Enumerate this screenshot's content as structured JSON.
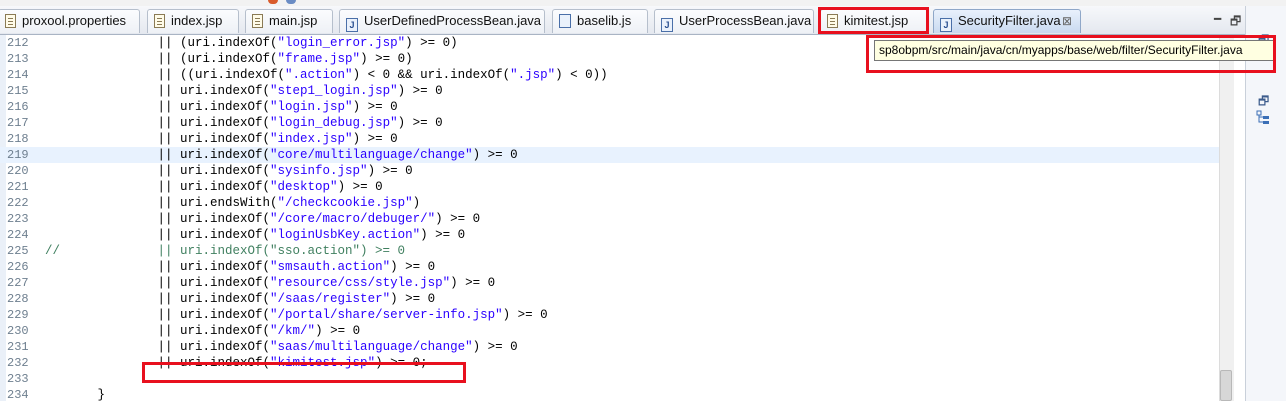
{
  "tabs": [
    {
      "label": "proxool.properties",
      "icon": "file-icon"
    },
    {
      "label": "index.jsp",
      "icon": "file-icon"
    },
    {
      "label": "main.jsp",
      "icon": "file-icon"
    },
    {
      "label": "UserDefinedProcessBean.java",
      "icon": "java-file-icon"
    },
    {
      "label": "baselib.js",
      "icon": "js-file-icon"
    },
    {
      "label": "UserProcessBean.java",
      "icon": "java-file-icon"
    },
    {
      "label": "kimitest.jsp",
      "icon": "file-icon"
    },
    {
      "label": "SecurityFilter.java",
      "icon": "java-file-icon",
      "active": true,
      "close": "⊠"
    }
  ],
  "tooltip": "sp8obpm/src/main/java/cn/myapps/base/web/filter/SecurityFilter.java",
  "window_buttons": {
    "minimize": "━",
    "maximize": "🗗"
  },
  "code_lines": [
    {
      "num": "212",
      "parts": [
        [
          "kw",
          "               || (uri.indexOf("
        ],
        [
          "str",
          "\"login_error.jsp\""
        ],
        [
          "kw",
          ") >= 0)"
        ]
      ]
    },
    {
      "num": "213",
      "parts": [
        [
          "kw",
          "               || (uri.indexOf("
        ],
        [
          "str",
          "\"frame.jsp\""
        ],
        [
          "kw",
          ") >= 0)"
        ]
      ]
    },
    {
      "num": "214",
      "parts": [
        [
          "kw",
          "               || ((uri.indexOf("
        ],
        [
          "str",
          "\".action\""
        ],
        [
          "kw",
          ") < 0 && uri.indexOf("
        ],
        [
          "str",
          "\".jsp\""
        ],
        [
          "kw",
          ") < 0))"
        ]
      ]
    },
    {
      "num": "215",
      "parts": [
        [
          "kw",
          "               || uri.indexOf("
        ],
        [
          "str",
          "\"step1_login.jsp\""
        ],
        [
          "kw",
          ") >= 0"
        ]
      ]
    },
    {
      "num": "216",
      "parts": [
        [
          "kw",
          "               || uri.indexOf("
        ],
        [
          "str",
          "\"login.jsp\""
        ],
        [
          "kw",
          ") >= 0"
        ]
      ]
    },
    {
      "num": "217",
      "parts": [
        [
          "kw",
          "               || uri.indexOf("
        ],
        [
          "str",
          "\"login_debug.jsp\""
        ],
        [
          "kw",
          ") >= 0"
        ]
      ]
    },
    {
      "num": "218",
      "parts": [
        [
          "kw",
          "               || uri.indexOf("
        ],
        [
          "str",
          "\"index.jsp\""
        ],
        [
          "kw",
          ") >= 0"
        ]
      ]
    },
    {
      "num": "219",
      "parts": [
        [
          "kw",
          "               || uri.indexOf("
        ],
        [
          "str",
          "\"core/multilanguage/change\""
        ],
        [
          "kw",
          ") >= 0"
        ]
      ],
      "current": true
    },
    {
      "num": "220",
      "parts": [
        [
          "kw",
          "               || uri.indexOf("
        ],
        [
          "str",
          "\"sysinfo.jsp\""
        ],
        [
          "kw",
          ") >= 0"
        ]
      ]
    },
    {
      "num": "221",
      "parts": [
        [
          "kw",
          "               || uri.indexOf("
        ],
        [
          "str",
          "\"desktop\""
        ],
        [
          "kw",
          ") >= 0"
        ]
      ]
    },
    {
      "num": "222",
      "parts": [
        [
          "kw",
          "               || uri.endsWith("
        ],
        [
          "str",
          "\"/checkcookie.jsp\""
        ],
        [
          "kw",
          ")"
        ]
      ]
    },
    {
      "num": "223",
      "parts": [
        [
          "kw",
          "               || uri.indexOf("
        ],
        [
          "str",
          "\"/core/macro/debuger/\""
        ],
        [
          "kw",
          ") >= 0"
        ]
      ]
    },
    {
      "num": "224",
      "parts": [
        [
          "kw",
          "               || uri.indexOf("
        ],
        [
          "str",
          "\"loginUsbKey.action\""
        ],
        [
          "kw",
          ") >= 0"
        ]
      ]
    },
    {
      "num": "225",
      "parts": [
        [
          "cmt",
          "//             || uri.indexOf(\"sso.action\") >= 0"
        ]
      ]
    },
    {
      "num": "226",
      "parts": [
        [
          "kw",
          "               || uri.indexOf("
        ],
        [
          "str",
          "\"smsauth.action\""
        ],
        [
          "kw",
          ") >= 0"
        ]
      ]
    },
    {
      "num": "227",
      "parts": [
        [
          "kw",
          "               || uri.indexOf("
        ],
        [
          "str",
          "\"resource/css/style.jsp\""
        ],
        [
          "kw",
          ") >= 0"
        ]
      ]
    },
    {
      "num": "228",
      "parts": [
        [
          "kw",
          "               || uri.indexOf("
        ],
        [
          "str",
          "\"/saas/register\""
        ],
        [
          "kw",
          ") >= 0"
        ]
      ]
    },
    {
      "num": "229",
      "parts": [
        [
          "kw",
          "               || uri.indexOf("
        ],
        [
          "str",
          "\"/portal/share/server-info.jsp\""
        ],
        [
          "kw",
          ") >= 0"
        ]
      ]
    },
    {
      "num": "230",
      "parts": [
        [
          "kw",
          "               || uri.indexOf("
        ],
        [
          "str",
          "\"/km/\""
        ],
        [
          "kw",
          ") >= 0"
        ]
      ]
    },
    {
      "num": "231",
      "parts": [
        [
          "kw",
          "               || uri.indexOf("
        ],
        [
          "str",
          "\"saas/multilanguage/change\""
        ],
        [
          "kw",
          ") >= 0"
        ]
      ]
    },
    {
      "num": "232",
      "parts": [
        [
          "kw",
          "               || uri.indexOf("
        ],
        [
          "str",
          "\"kimitest.jsp\""
        ],
        [
          "kw",
          ") >= 0;"
        ]
      ]
    },
    {
      "num": "233",
      "parts": [
        [
          "kw",
          ""
        ]
      ]
    },
    {
      "num": "234",
      "parts": [
        [
          "kw",
          "       }"
        ]
      ]
    }
  ],
  "colors": {
    "keyword": "#000000",
    "string": "#2a00ff",
    "comment": "#3f7f5f",
    "annotation_red": "#e8101e",
    "tooltip_bg": "#ffffe1"
  }
}
